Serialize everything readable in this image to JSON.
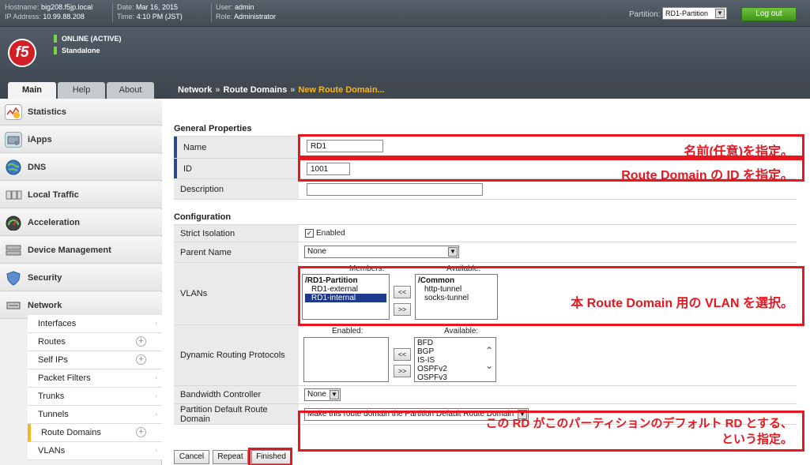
{
  "header": {
    "hostname_label": "Hostname:",
    "hostname": "big208.f5jp.local",
    "ip_label": "IP Address:",
    "ip": "10.99.88.208",
    "date_label": "Date:",
    "date": "Mar 16, 2015",
    "time_label": "Time:",
    "time": "4:10 PM (JST)",
    "user_label": "User:",
    "user": "admin",
    "role_label": "Role:",
    "role": "Administrator",
    "partition_label": "Partition:",
    "partition_value": "RD1-Partition",
    "logout_label": "Log out",
    "logo_text": "f5",
    "status_line1": "ONLINE (ACTIVE)",
    "status_line2": "Standalone",
    "status_color": "#7bd148"
  },
  "tabs": [
    "Main",
    "Help",
    "About"
  ],
  "breadcrumb": {
    "items": [
      "Network",
      "Route Domains"
    ],
    "separator": "»",
    "current": "New Route Domain..."
  },
  "sidebar": {
    "items": [
      {
        "label": "Statistics",
        "icon": "statistics-icon"
      },
      {
        "label": "iApps",
        "icon": "iapps-icon"
      },
      {
        "label": "DNS",
        "icon": "dns-globe-icon"
      },
      {
        "label": "Local Traffic",
        "icon": "local-traffic-icon"
      },
      {
        "label": "Acceleration",
        "icon": "gauge-icon"
      },
      {
        "label": "Device Management",
        "icon": "device-management-icon"
      },
      {
        "label": "Security",
        "icon": "shield-icon"
      },
      {
        "label": "Network",
        "icon": "network-icon"
      }
    ],
    "subitems": [
      {
        "label": "Interfaces",
        "plus": false
      },
      {
        "label": "Routes",
        "plus": true
      },
      {
        "label": "Self IPs",
        "plus": true
      },
      {
        "label": "Packet Filters",
        "plus": false
      },
      {
        "label": "Trunks",
        "plus": false
      },
      {
        "label": "Tunnels",
        "plus": false
      },
      {
        "label": "Route Domains",
        "plus": true,
        "selected": true
      },
      {
        "label": "VLANs",
        "plus": false
      }
    ]
  },
  "form": {
    "general_title": "General Properties",
    "name_label": "Name",
    "name_value": "RD1",
    "id_label": "ID",
    "id_value": "1001",
    "description_label": "Description",
    "description_value": "",
    "config_title": "Configuration",
    "strict_label": "Strict Isolation",
    "strict_checked": true,
    "strict_text": "Enabled",
    "parent_label": "Parent Name",
    "parent_value": "None",
    "vlans_label": "VLANs",
    "members_header": "Members:",
    "available_header": "Available:",
    "members": [
      "/RD1-Partition",
      "RD1-external",
      "RD1-internal"
    ],
    "available_vlans": [
      "/Common",
      "http-tunnel",
      "socks-tunnel"
    ],
    "move_left": "<<",
    "move_right": ">>",
    "drp_label": "Dynamic Routing Protocols",
    "enabled_header": "Enabled:",
    "drp_available": [
      "BFD",
      "BGP",
      "IS-IS",
      "OSPFv2",
      "OSPFv3"
    ],
    "bw_label": "Bandwidth Controller",
    "bw_value": "None",
    "pdrd_label": "Partition Default Route Domain",
    "pdrd_value": "Make this route domain the Partition Default Route Domain",
    "cancel_label": "Cancel",
    "repeat_label": "Repeat",
    "finished_label": "Finished"
  },
  "annotations": {
    "name_note": "名前(任意)を指定。",
    "id_note": "Route Domain の ID を指定。",
    "vlan_note": "本 Route Domain 用の VLAN を選択。",
    "pdrd_note1": "この RD がこのパーティションのデフォルト RD とする、",
    "pdrd_note2": "という指定。",
    "color": "#e8161f"
  }
}
